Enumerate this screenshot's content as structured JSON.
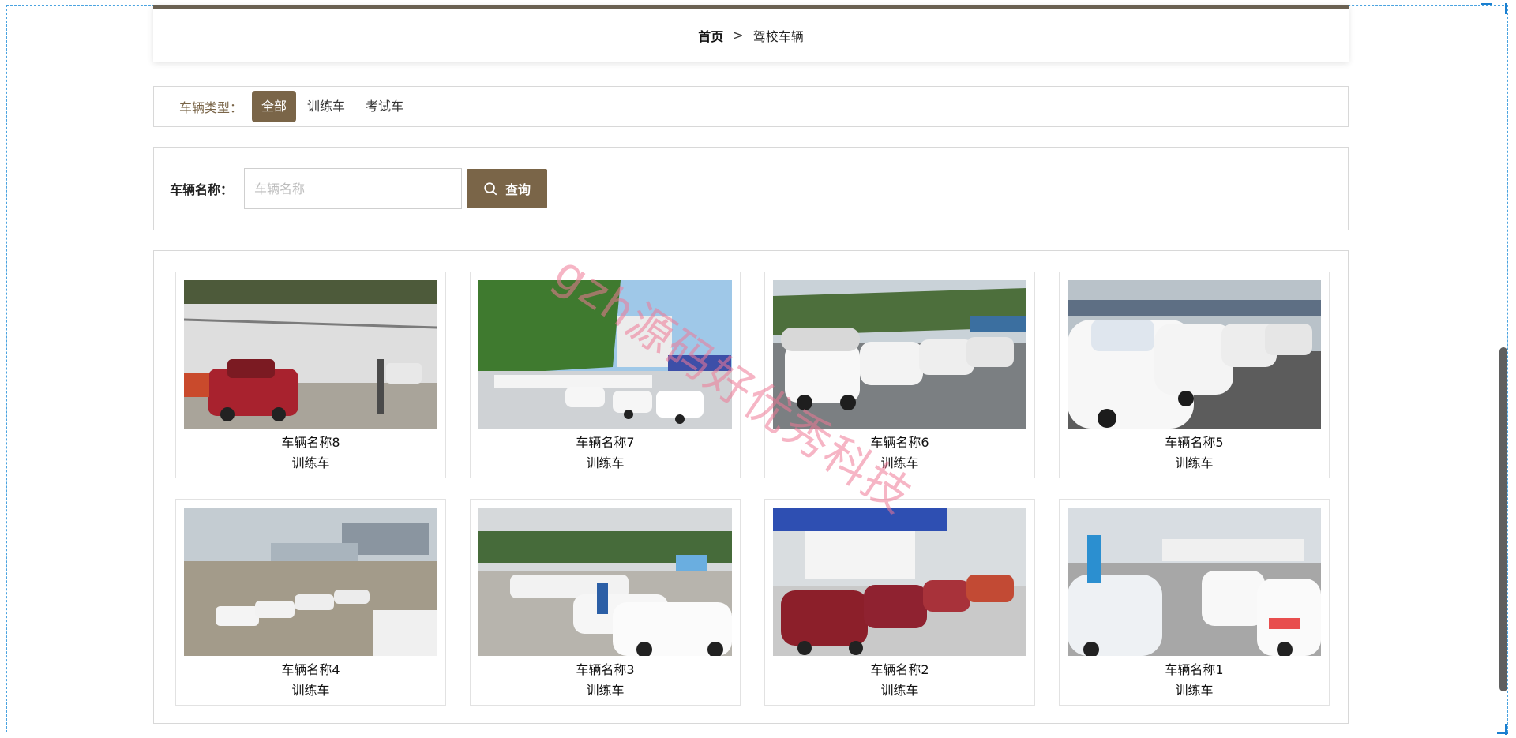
{
  "breadcrumb": {
    "home": "首页",
    "separator": ">",
    "current": "驾校车辆"
  },
  "type_filter": {
    "label": "车辆类型：",
    "options": [
      "全部",
      "训练车",
      "考试车"
    ],
    "active": "全部"
  },
  "search": {
    "label": "车辆名称：",
    "placeholder": "车辆名称",
    "value": "",
    "button": "查询"
  },
  "vehicles": [
    {
      "name": "车辆名称8",
      "type": "训练车"
    },
    {
      "name": "车辆名称7",
      "type": "训练车"
    },
    {
      "name": "车辆名称6",
      "type": "训练车"
    },
    {
      "name": "车辆名称5",
      "type": "训练车"
    },
    {
      "name": "车辆名称4",
      "type": "训练车"
    },
    {
      "name": "车辆名称3",
      "type": "训练车"
    },
    {
      "name": "车辆名称2",
      "type": "训练车"
    },
    {
      "name": "车辆名称1",
      "type": "训练车"
    }
  ],
  "watermark": "gzh源码好优秀科技",
  "colors": {
    "accent": "#7a6548",
    "watermark": "#ee7896"
  }
}
